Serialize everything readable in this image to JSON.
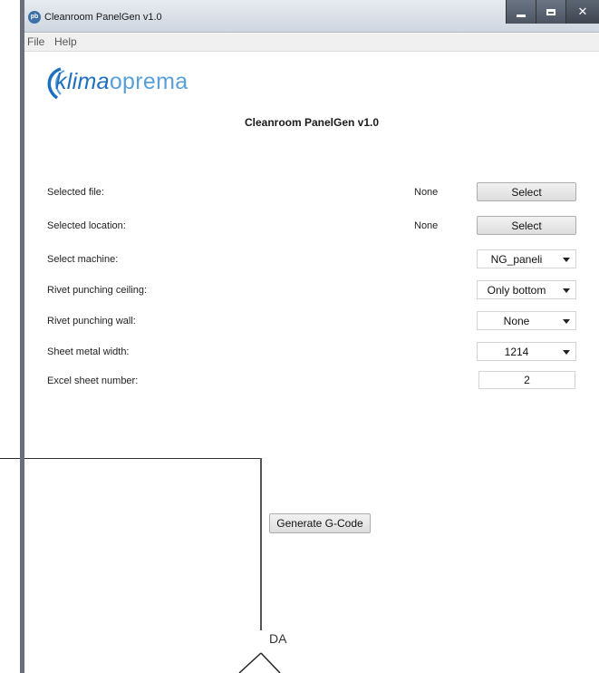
{
  "window": {
    "title": "Cleanroom PanelGen v1.0",
    "app_icon_text": "pb"
  },
  "menu": {
    "items": [
      {
        "label": "File"
      },
      {
        "label": "Help"
      }
    ]
  },
  "logo": {
    "brand_part1": "klima",
    "brand_part2": "oprema",
    "color_primary": "#1d6fc0",
    "color_secondary": "#5aa0d8"
  },
  "heading": "Cleanroom PanelGen v1.0",
  "form": {
    "selected_file": {
      "label": "Selected file:",
      "value": "None",
      "button": "Select"
    },
    "selected_location": {
      "label": "Selected location:",
      "value": "None",
      "button": "Select"
    },
    "machine": {
      "label": "Select machine:",
      "selected": "NG_paneli"
    },
    "rivet_ceiling": {
      "label": "Rivet punching ceiling:",
      "selected": "Only bottom"
    },
    "rivet_wall": {
      "label": "Rivet punching wall:",
      "selected": "None"
    },
    "sheet_width": {
      "label": "Sheet metal width:",
      "selected": "1214"
    },
    "excel_sheet": {
      "label": "Excel sheet number:",
      "value": "2"
    }
  },
  "generate_button": "Generate G-Code",
  "background": {
    "diagram_label": "DA"
  }
}
